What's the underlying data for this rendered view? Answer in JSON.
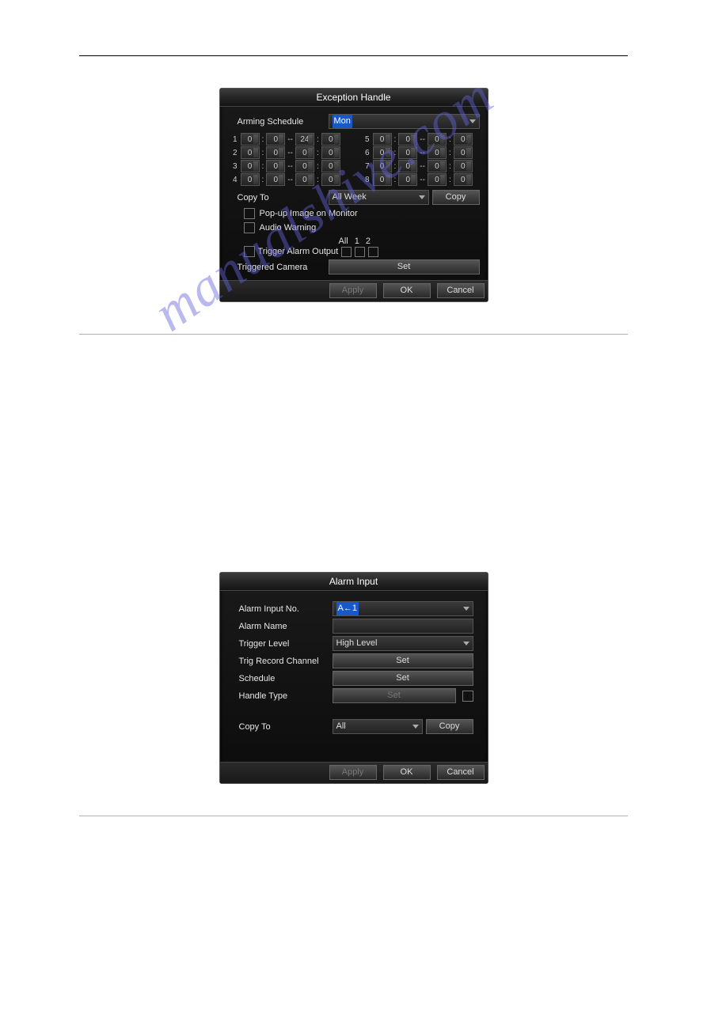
{
  "watermark": "manualshive.com",
  "dialog1": {
    "title": "Exception Handle",
    "arming_label": "Arming Schedule",
    "arming_selected": "Mon",
    "schedule": {
      "left": [
        {
          "idx": "1",
          "h1": "0",
          "m1": "0",
          "h2": "24",
          "m2": "0"
        },
        {
          "idx": "2",
          "h1": "0",
          "m1": "0",
          "h2": "0",
          "m2": "0"
        },
        {
          "idx": "3",
          "h1": "0",
          "m1": "0",
          "h2": "0",
          "m2": "0"
        },
        {
          "idx": "4",
          "h1": "0",
          "m1": "0",
          "h2": "0",
          "m2": "0"
        }
      ],
      "right": [
        {
          "idx": "5",
          "h1": "0",
          "m1": "0",
          "h2": "0",
          "m2": "0"
        },
        {
          "idx": "6",
          "h1": "0",
          "m1": "0",
          "h2": "0",
          "m2": "0"
        },
        {
          "idx": "7",
          "h1": "0",
          "m1": "0",
          "h2": "0",
          "m2": "0"
        },
        {
          "idx": "8",
          "h1": "0",
          "m1": "0",
          "h2": "0",
          "m2": "0"
        }
      ]
    },
    "copyto_label": "Copy To",
    "copyto_selected": "All Week",
    "copy_btn": "Copy",
    "popup_label": "Pop-up Image on Monitor",
    "audio_label": "Audio Warning",
    "trigger_head_all": "All",
    "trigger_head_1": "1",
    "trigger_head_2": "2",
    "trigger_label": "Trigger Alarm Output",
    "triggered_cam_label": "Triggered Camera",
    "set_btn": "Set",
    "apply_btn": "Apply",
    "ok_btn": "OK",
    "cancel_btn": "Cancel"
  },
  "dialog2": {
    "title": "Alarm Input",
    "alarm_no_label": "Alarm Input No.",
    "alarm_no_value": "A←1",
    "alarm_name_label": "Alarm Name",
    "trigger_level_label": "Trigger Level",
    "trigger_level_value": "High Level",
    "trig_record_label": "Trig Record Channel",
    "schedule_label": "Schedule",
    "handle_type_label": "Handle Type",
    "set_btn": "Set",
    "copyto_label": "Copy To",
    "copyto_value": "All",
    "copy_btn": "Copy",
    "apply_btn": "Apply",
    "ok_btn": "OK",
    "cancel_btn": "Cancel"
  }
}
